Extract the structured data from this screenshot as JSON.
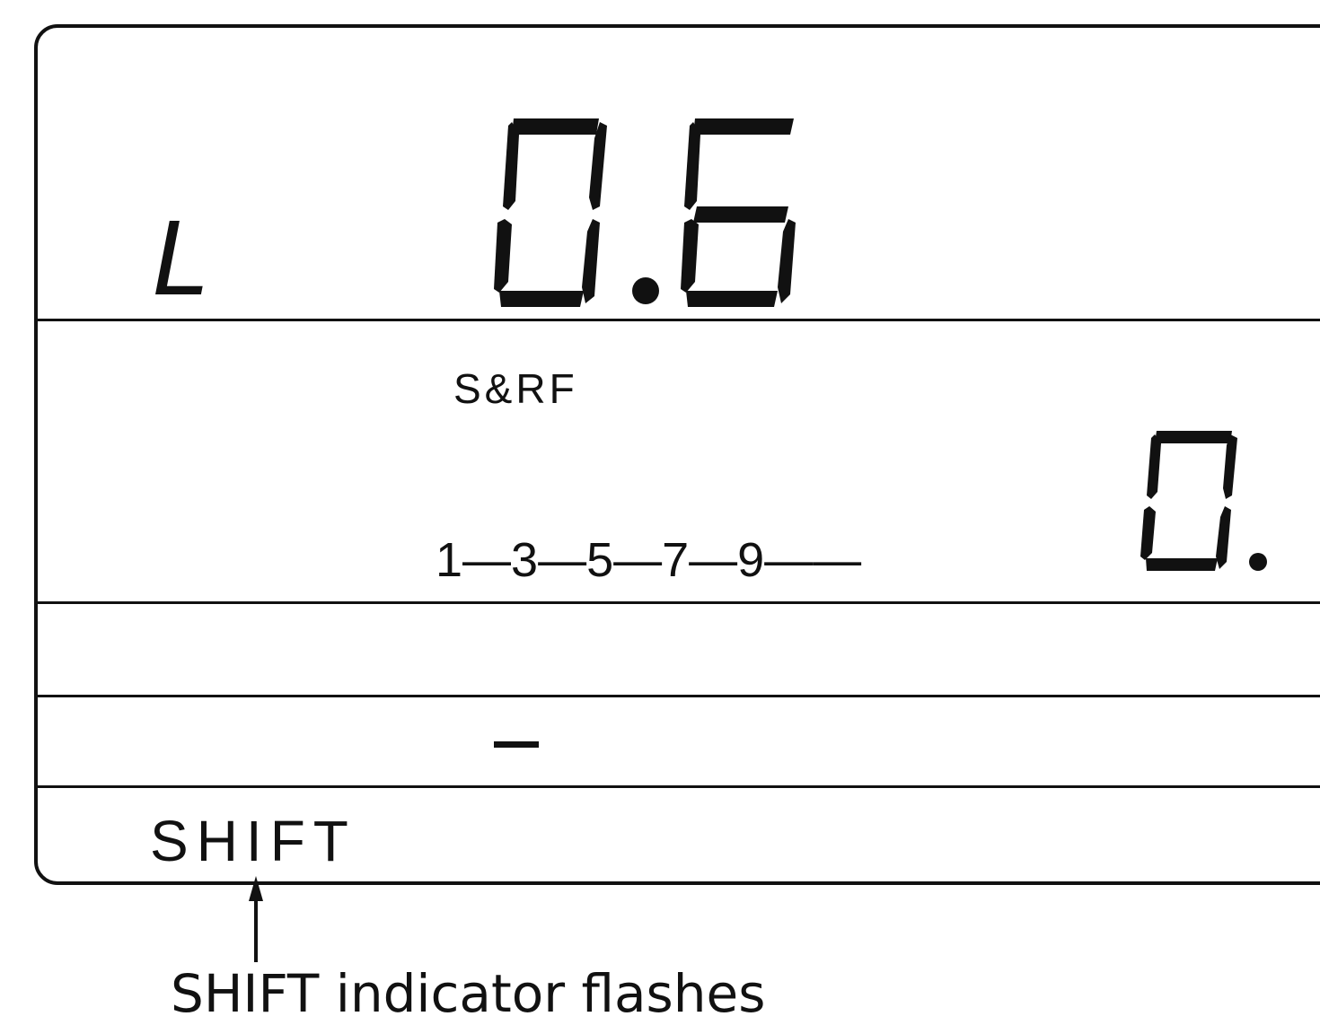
{
  "display": {
    "channel_indicator": "L",
    "main_value": "0.6",
    "mode_label": "S&RF",
    "harmonics_scale": "1—3—5—7—9——",
    "secondary_value": "0.",
    "dash_segment": "—",
    "shift_indicator": "SHIFT"
  },
  "annotation": {
    "caption": "SHIFT indicator flashes"
  }
}
